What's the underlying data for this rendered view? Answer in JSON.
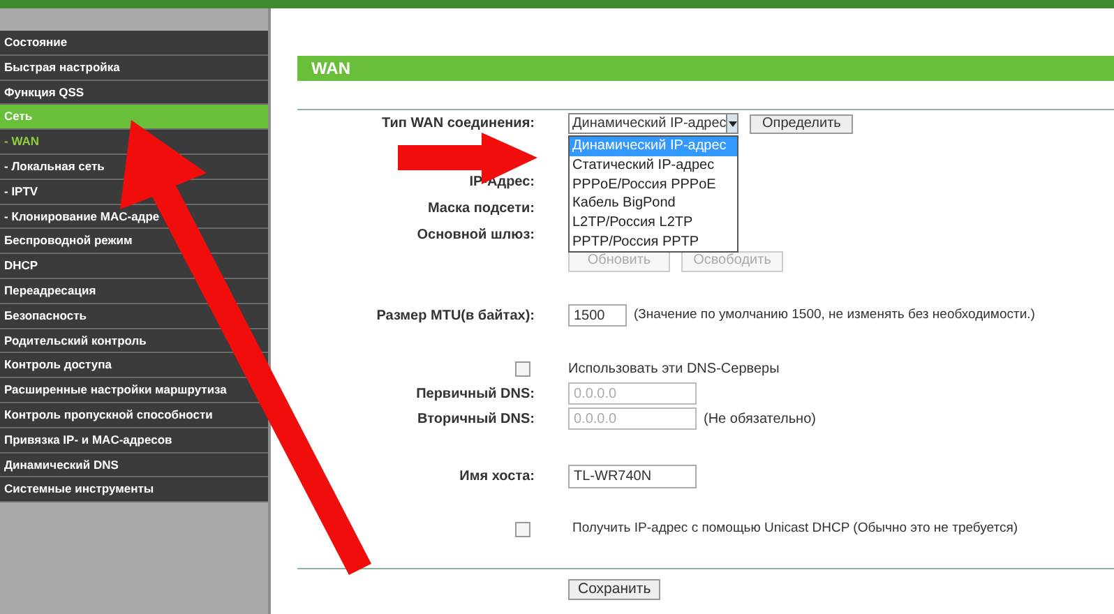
{
  "sidebar": {
    "items": [
      {
        "label": "Состояние",
        "kind": "section",
        "selected": false
      },
      {
        "label": "Быстрая настройка",
        "kind": "section",
        "selected": false
      },
      {
        "label": "Функция QSS",
        "kind": "section",
        "selected": false
      },
      {
        "label": "Сеть",
        "kind": "section",
        "selected": true
      },
      {
        "label": "- WAN",
        "kind": "subitem",
        "selected": true
      },
      {
        "label": "- Локальная сеть",
        "kind": "subitem",
        "selected": false
      },
      {
        "label": "- IPTV",
        "kind": "subitem",
        "selected": false
      },
      {
        "label": "- Клонирование MAC-адре",
        "kind": "subitem",
        "selected": false
      },
      {
        "label": "Беспроводной режим",
        "kind": "section",
        "selected": false
      },
      {
        "label": "DHCP",
        "kind": "section",
        "selected": false
      },
      {
        "label": "Переадресация",
        "kind": "section",
        "selected": false
      },
      {
        "label": "Безопасность",
        "kind": "section",
        "selected": false
      },
      {
        "label": "Родительский контроль",
        "kind": "section",
        "selected": false
      },
      {
        "label": "Контроль доступа",
        "kind": "section",
        "selected": false
      },
      {
        "label": "Расширенные настройки маршрутиза",
        "kind": "section",
        "selected": false
      },
      {
        "label": "Контроль пропускной способности",
        "kind": "section",
        "selected": false
      },
      {
        "label": "Привязка IP- и MAC-адресов",
        "kind": "section",
        "selected": false
      },
      {
        "label": "Динамический DNS",
        "kind": "section",
        "selected": false
      },
      {
        "label": "Системные инструменты",
        "kind": "section",
        "selected": false
      }
    ]
  },
  "panel": {
    "title": "WAN",
    "connection_type": {
      "label": "Тип WAN соединения:",
      "value": "Динамический IP-адрес",
      "button": "Определить",
      "expanded": true,
      "options": [
        {
          "label": "Динамический IP-адрес",
          "selected": true
        },
        {
          "label": "Статический IP-адрес",
          "selected": false
        },
        {
          "label": "PPPoE/Россия PPPoE",
          "selected": false
        },
        {
          "label": "Кабель BigPond",
          "selected": false
        },
        {
          "label": "L2TP/Россия L2TP",
          "selected": false
        },
        {
          "label": "PPTP/Россия PPTP",
          "selected": false
        }
      ]
    },
    "address_labels": [
      "IP-Адрес:",
      "Маска подсети:",
      "Основной шлюз:"
    ],
    "dhcp_buttons": [
      {
        "label": "Обновить",
        "disabled": true
      },
      {
        "label": "Освободить",
        "disabled": true
      }
    ],
    "mtu": {
      "label": "Размер MTU(в байтах):",
      "value": "1500",
      "hint": "(Значение по умолчанию 1500, не изменять без необходимости.)"
    },
    "dns_checkbox": {
      "label": "Использовать эти DNS-Серверы",
      "checked": false
    },
    "dns_fields": [
      {
        "label": "Первичный DNS:",
        "value": "0.0.0.0",
        "disabled": true
      },
      {
        "label": "Вторичный DNS:",
        "value": "0.0.0.0",
        "disabled": true,
        "note": "(Не обязательно)"
      }
    ],
    "hostname": {
      "label": "Имя хоста:",
      "value": "TL-WR740N"
    },
    "unicast_checkbox": {
      "label": "Получить IP-адрес с помощью Unicast DHCP (Обычно это не требуется)",
      "checked": false
    },
    "save_button": "Сохранить"
  }
}
